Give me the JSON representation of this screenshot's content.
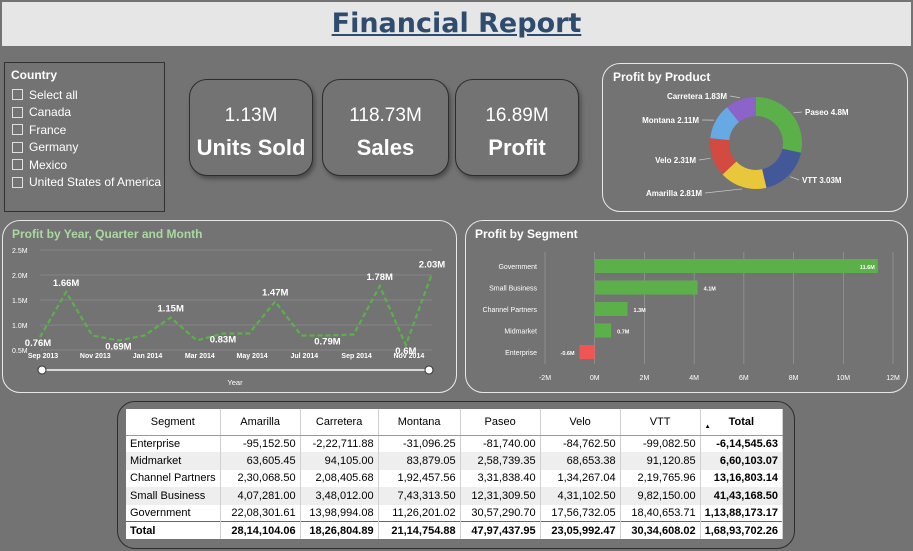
{
  "title": "Financial Report",
  "slicer": {
    "header": "Country",
    "items": [
      "Select all",
      "Canada",
      "France",
      "Germany",
      "Mexico",
      "United States of America"
    ]
  },
  "cards": [
    {
      "value": "1.13M",
      "label": "Units Sold"
    },
    {
      "value": "118.73M",
      "label": "Sales"
    },
    {
      "value": "16.89M",
      "label": "Profit"
    }
  ],
  "donut": {
    "title": "Profit by Product",
    "slices": [
      {
        "name": "Paseo",
        "label": "Paseo 4.8M",
        "value": 4.8,
        "color": "#5cb04a"
      },
      {
        "name": "VTT",
        "label": "VTT 3.03M",
        "value": 3.03,
        "color": "#435898"
      },
      {
        "name": "Amarilla",
        "label": "Amarilla 2.81M",
        "value": 2.81,
        "color": "#e8c83a"
      },
      {
        "name": "Velo",
        "label": "Velo 2.31M",
        "value": 2.31,
        "color": "#d24a40"
      },
      {
        "name": "Montana",
        "label": "Montana 2.11M",
        "value": 2.11,
        "color": "#67a9e2"
      },
      {
        "name": "Carretera",
        "label": "Carretera 1.83M",
        "value": 1.83,
        "color": "#8c63c9"
      }
    ]
  },
  "line": {
    "title": "Profit by Year, Quarter and Month",
    "xlabel": "Year",
    "y_ticks": [
      "0.5M",
      "1.0M",
      "1.5M",
      "2.0M",
      "2.5M"
    ],
    "x_ticks": [
      "Sep 2013",
      "Nov 2013",
      "Jan 2014",
      "Mar 2014",
      "May 2014",
      "Jul 2014",
      "Sep 2014",
      "Nov 2014"
    ],
    "labels": [
      "0.76M",
      "1.66M",
      "0.69M",
      "1.15M",
      "0.83M",
      "1.47M",
      "0.79M",
      "1.78M",
      "0.6M",
      "2.03M"
    ],
    "color": "#5cb04a"
  },
  "bar": {
    "title": "Profit by Segment",
    "x_ticks": [
      "-2M",
      "0M",
      "2M",
      "4M",
      "6M",
      "8M",
      "10M",
      "12M"
    ],
    "labels": [
      "11.6M",
      "4.1M",
      "1.3M",
      "0.7M",
      "-0.6M"
    ],
    "positive_color": "#5cb04a",
    "negative_color": "#f05555"
  },
  "chart_data": [
    {
      "type": "pie",
      "title": "Profit by Product",
      "categories": [
        "Paseo",
        "VTT",
        "Amarilla",
        "Velo",
        "Montana",
        "Carretera"
      ],
      "values": [
        4.8,
        3.03,
        2.81,
        2.31,
        2.11,
        1.83
      ]
    },
    {
      "type": "line",
      "title": "Profit by Year, Quarter and Month",
      "xlabel": "Year",
      "x": [
        "Sep 2013",
        "Oct 2013",
        "Nov 2013",
        "Dec 2013",
        "Jan 2014",
        "Feb 2014",
        "Mar 2014",
        "Apr 2014",
        "May 2014",
        "Jun 2014",
        "Jul 2014",
        "Aug 2014",
        "Sep 2014",
        "Oct 2014",
        "Nov 2014",
        "Dec 2014"
      ],
      "values": [
        0.76,
        1.66,
        0.79,
        0.69,
        0.79,
        1.15,
        0.69,
        0.83,
        0.83,
        1.47,
        0.79,
        0.79,
        0.81,
        1.78,
        0.6,
        2.03
      ],
      "ylim": [
        0.5,
        2.5
      ]
    },
    {
      "type": "bar",
      "title": "Profit by Segment",
      "categories": [
        "Government",
        "Small Business",
        "Channel Partners",
        "Midmarket",
        "Enterprise"
      ],
      "values": [
        11.39,
        4.14,
        1.32,
        0.66,
        -0.61
      ],
      "xlim": [
        -2,
        12
      ]
    }
  ],
  "table": {
    "headers": [
      "Segment",
      "Amarilla",
      "Carretera",
      "Montana",
      "Paseo",
      "Velo",
      "VTT",
      "Total"
    ],
    "rows": [
      [
        "Enterprise",
        "-95,152.50",
        "-2,22,711.88",
        "-31,096.25",
        "-81,740.00",
        "-84,762.50",
        "-99,082.50",
        "-6,14,545.63"
      ],
      [
        "Midmarket",
        "63,605.45",
        "94,105.00",
        "83,879.05",
        "2,58,739.35",
        "68,653.38",
        "91,120.85",
        "6,60,103.07"
      ],
      [
        "Channel Partners",
        "2,30,068.50",
        "2,08,405.68",
        "1,92,457.56",
        "3,31,838.40",
        "1,34,267.04",
        "2,19,765.96",
        "13,16,803.14"
      ],
      [
        "Small Business",
        "4,07,281.00",
        "3,48,012.00",
        "7,43,313.50",
        "12,31,309.50",
        "4,31,102.50",
        "9,82,150.00",
        "41,43,168.50"
      ],
      [
        "Government",
        "22,08,301.61",
        "13,98,994.08",
        "11,26,201.02",
        "30,57,290.70",
        "17,56,732.05",
        "18,40,653.71",
        "1,13,88,173.17"
      ],
      [
        "Total",
        "28,14,104.06",
        "18,26,804.89",
        "21,14,754.88",
        "47,97,437.95",
        "23,05,992.47",
        "30,34,608.02",
        "1,68,93,702.26"
      ]
    ]
  }
}
